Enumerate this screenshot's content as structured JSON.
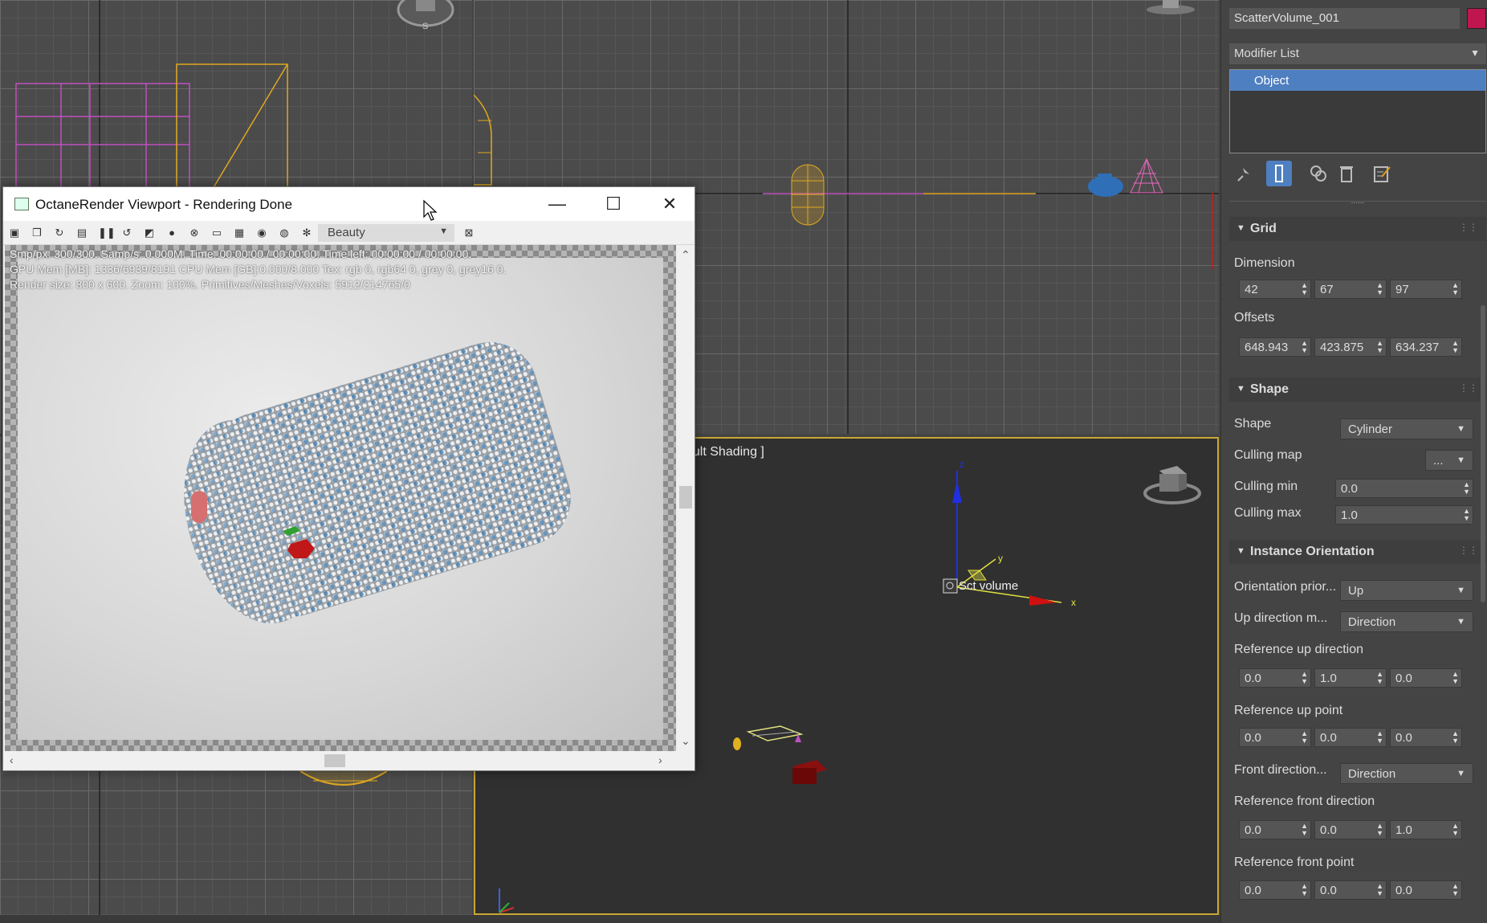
{
  "command_panel": {
    "object_name": "ScatterVolume_001",
    "object_color": "#c01650",
    "modifier_list": "Modifier List",
    "stack_item": "Object",
    "tools": [
      "pin-stack-icon",
      "show-end-result-icon",
      "make-unique-icon",
      "remove-modifier-icon",
      "configure-modifier-sets-icon"
    ],
    "grid": {
      "title": "Grid",
      "dimension_label": "Dimension",
      "dimension": [
        "42",
        "67",
        "97"
      ],
      "offsets_label": "Offsets",
      "offsets": [
        "648.943",
        "423.875",
        "634.237"
      ]
    },
    "shape": {
      "title": "Shape",
      "shape_label": "Shape",
      "shape_value": "Cylinder",
      "culling_map_label": "Culling map",
      "culling_map_value": "...",
      "culling_min_label": "Culling min",
      "culling_min": "0.0",
      "culling_max_label": "Culling max",
      "culling_max": "1.0"
    },
    "instance_orientation": {
      "title": "Instance Orientation",
      "orientation_priority_label": "Orientation prior...",
      "orientation_priority": "Up",
      "up_direction_mode_label": "Up direction m...",
      "up_direction_mode": "Direction",
      "ref_up_direction_label": "Reference up direction",
      "ref_up_direction": [
        "0.0",
        "1.0",
        "0.0"
      ],
      "ref_up_point_label": "Reference up point",
      "ref_up_point": [
        "0.0",
        "0.0",
        "0.0"
      ],
      "front_direction_label": "Front direction...",
      "front_direction": "Direction",
      "ref_front_direction_label": "Reference front direction",
      "ref_front_direction": [
        "0.0",
        "0.0",
        "1.0"
      ],
      "ref_front_point_label": "Reference front point",
      "ref_front_point": [
        "0.0",
        "0.0",
        "0.0"
      ]
    }
  },
  "octane": {
    "title": "OctaneRender Viewport - Rendering Done",
    "pass": "Beauty",
    "stats_line1": "Smp/px: 300/300.  Samp/s: 0.000M.  Time: 00:00:00 / 00:00:00.  Time left: 00:00:00 / 00:00:00.",
    "stats_line2": "GPU Mem [MB]: 1336/6939/8191  CPU Mem [GB]:0.000/8.000  Tex: rgb 0, rgb64 0, grey 0, grey16 0.",
    "stats_line3": "Render size: 800 x 600.  Zoom: 100%.  Primitives/Meshes/Voxels: 5912/214765/0"
  },
  "perspective": {
    "label": "ault Shading ]",
    "object_label": "Sct volume"
  }
}
